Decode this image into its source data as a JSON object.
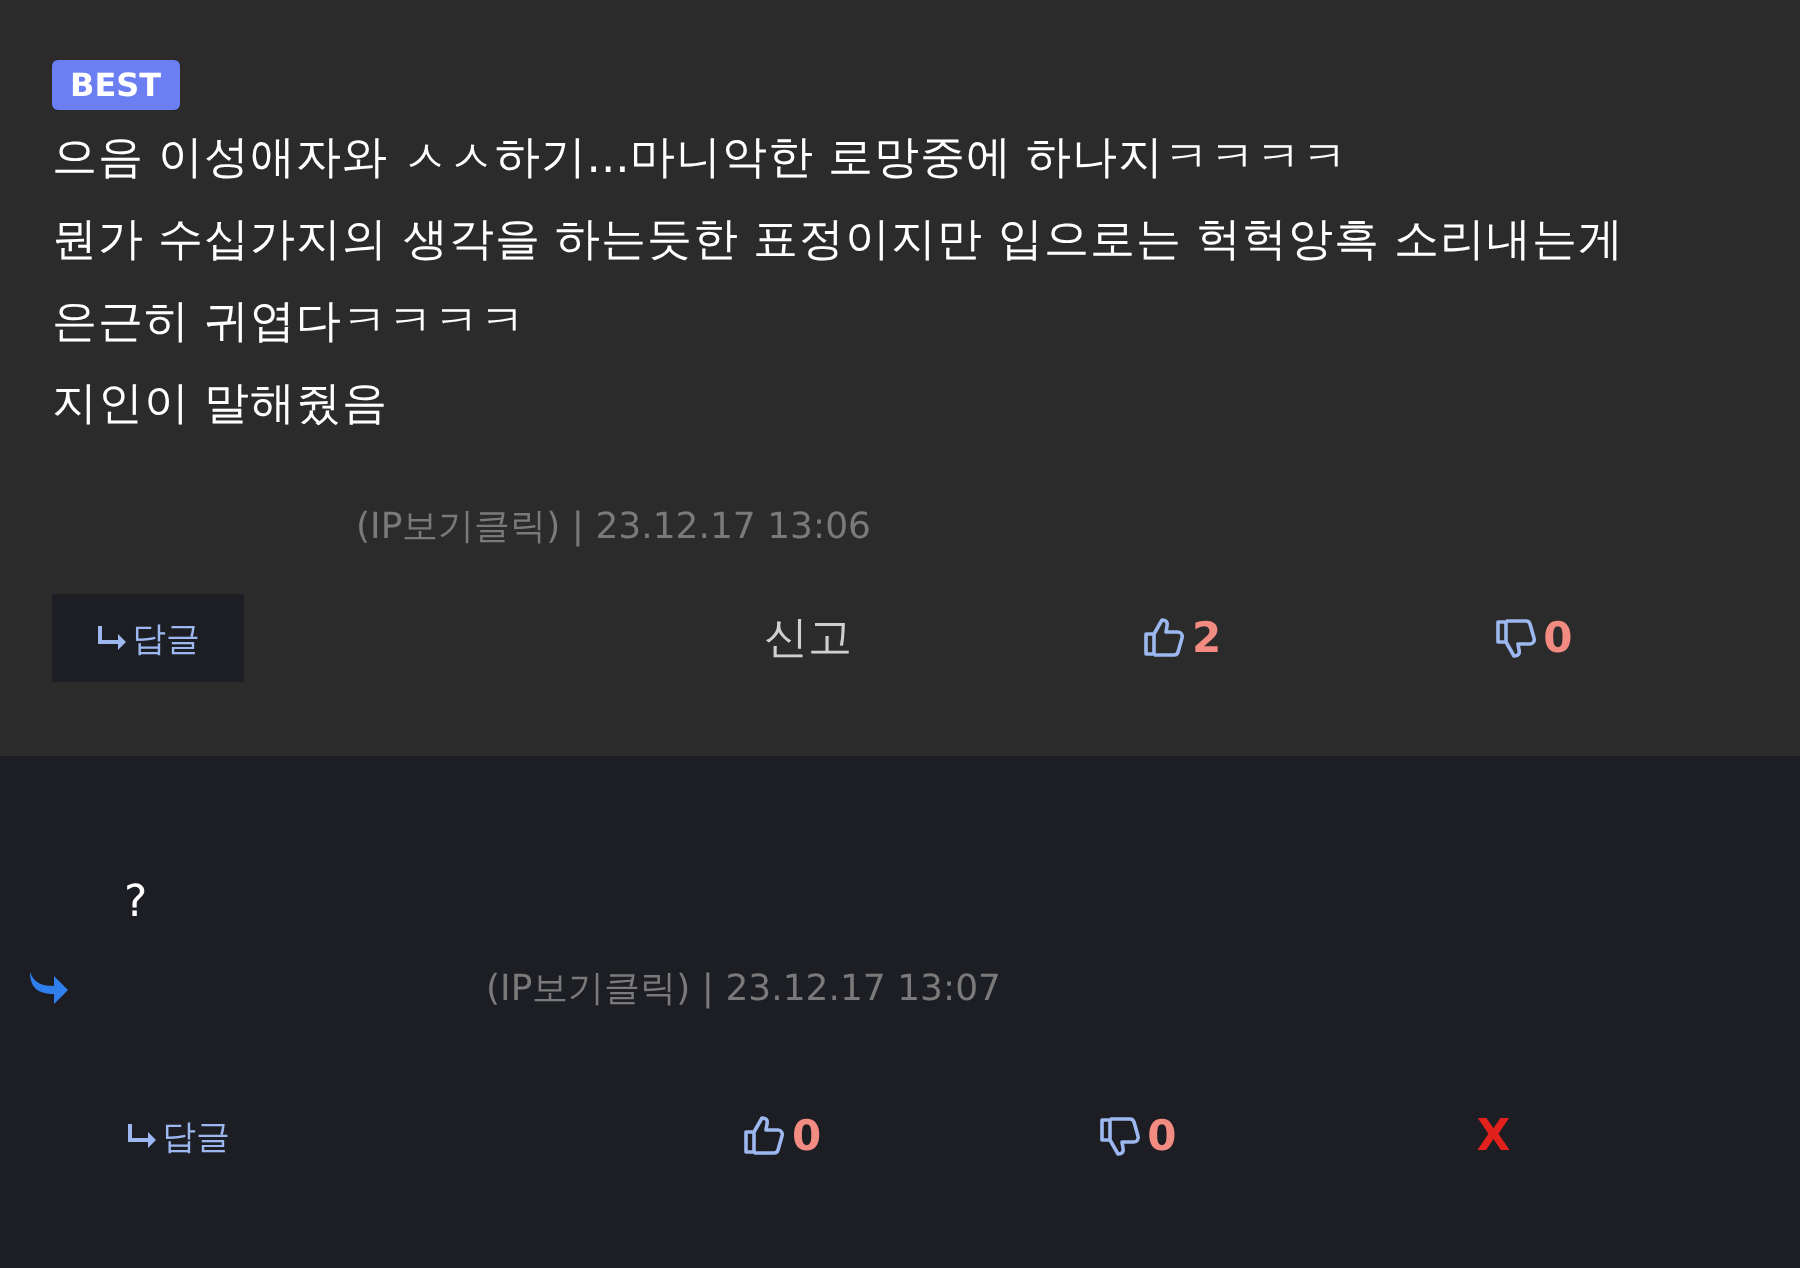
{
  "comments": [
    {
      "kind": "comment",
      "badge": "BEST",
      "lines": [
        "으음 이성애자와 ㅅㅅ하기...마니악한 로망중에 하나지ㅋㅋㅋㅋ",
        "뭔가 수십가지의 생각을 하는듯한 표정이지만 입으로는 헉헉앙흑 소리내는게",
        "은근히 귀엽다ㅋㅋㅋㅋ",
        "지인이 말해줬음"
      ],
      "meta": "(IP보기클릭) | 23.12.17 13:06",
      "reply": "답글",
      "report": "신고",
      "likes": "2",
      "dislikes": "0"
    },
    {
      "kind": "reply",
      "lines": [
        "?"
      ],
      "meta": "(IP보기클릭) | 23.12.17 13:07",
      "reply": "답글",
      "likes": "0",
      "dislikes": "0",
      "delete": "X"
    }
  ]
}
